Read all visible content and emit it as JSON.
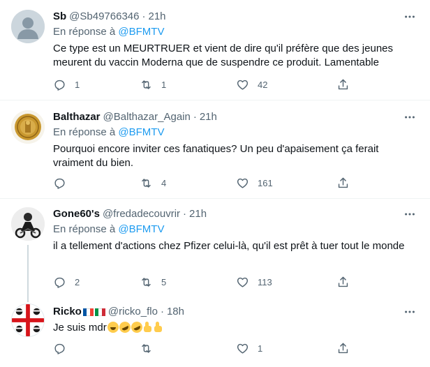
{
  "tweets": [
    {
      "name": "Sb",
      "handle": "@Sb49766346",
      "dot": "·",
      "time": "21h",
      "reply_prefix": "En réponse à",
      "reply_to": "@BFMTV",
      "text": "Ce type est un MEURTRUER et vient de dire qu'il préfère que des jeunes meurent du vaccin Moderna que de suspendre ce produit. Lamentable",
      "replies": "1",
      "retweets": "1",
      "likes": "42"
    },
    {
      "name": "Balthazar",
      "handle": "@Balthazar_Again",
      "dot": "·",
      "time": "21h",
      "reply_prefix": "En réponse à",
      "reply_to": "@BFMTV",
      "text": "Pourquoi encore inviter ces fanatiques? Un peu d'apaisement ça ferait vraiment du bien.",
      "replies": "",
      "retweets": "4",
      "likes": "161"
    },
    {
      "name": "Gone60's",
      "handle": "@fredadecouvrir",
      "dot": "·",
      "time": "21h",
      "reply_prefix": "En réponse à",
      "reply_to": "@BFMTV",
      "text": "il a tellement d'actions chez Pfizer celui-là, qu'il est prêt à tuer tout le monde",
      "replies": "2",
      "retweets": "5",
      "likes": "113"
    },
    {
      "name": "Ricko",
      "handle": "@ricko_flo",
      "dot": "·",
      "time": "18h",
      "text": "Je suis mdr",
      "replies": "",
      "retweets": "",
      "likes": "1"
    }
  ],
  "colors": {
    "link": "#1d9bf0",
    "secondary": "#536471",
    "border": "#eff3f4",
    "thread": "#cfd9de"
  },
  "icons": [
    "reply-icon",
    "retweet-icon",
    "like-icon",
    "share-icon",
    "more-icon"
  ]
}
